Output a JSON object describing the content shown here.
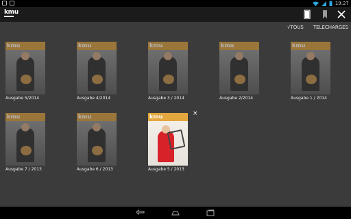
{
  "status_bar": {
    "time": "19:27",
    "left_icons": [
      "notification-icon",
      "message-icon"
    ],
    "right_icons": [
      "wifi-icon",
      "signal-icon",
      "battery-icon"
    ]
  },
  "action_bar": {
    "logo": "kmu",
    "actions": [
      "grid-view-icon",
      "bookmark-icon",
      "close-icon"
    ]
  },
  "filters": {
    "tous": "√TOUS",
    "telecharges": "TELECHARGES"
  },
  "issues": [
    {
      "label": "Ausgabe 5/2014",
      "downloaded": false
    },
    {
      "label": "Ausgabe 4/2014",
      "downloaded": false
    },
    {
      "label": "Ausgabe 3 / 2014",
      "downloaded": false
    },
    {
      "label": "Ausgabe 2/2014",
      "downloaded": false
    },
    {
      "label": "Ausgabe 1 / 2014",
      "downloaded": false
    },
    {
      "label": "Ausgabe 7 / 2013",
      "downloaded": false
    },
    {
      "label": "Ausgabe 6 / 2013",
      "downloaded": false
    },
    {
      "label": "Ausgabe 5 / 2013",
      "downloaded": true
    }
  ],
  "delete_glyph": "×",
  "colors": {
    "background": "#3b3b3b",
    "action_bar": "#1b1b1b",
    "accent": "#d59a3a"
  }
}
